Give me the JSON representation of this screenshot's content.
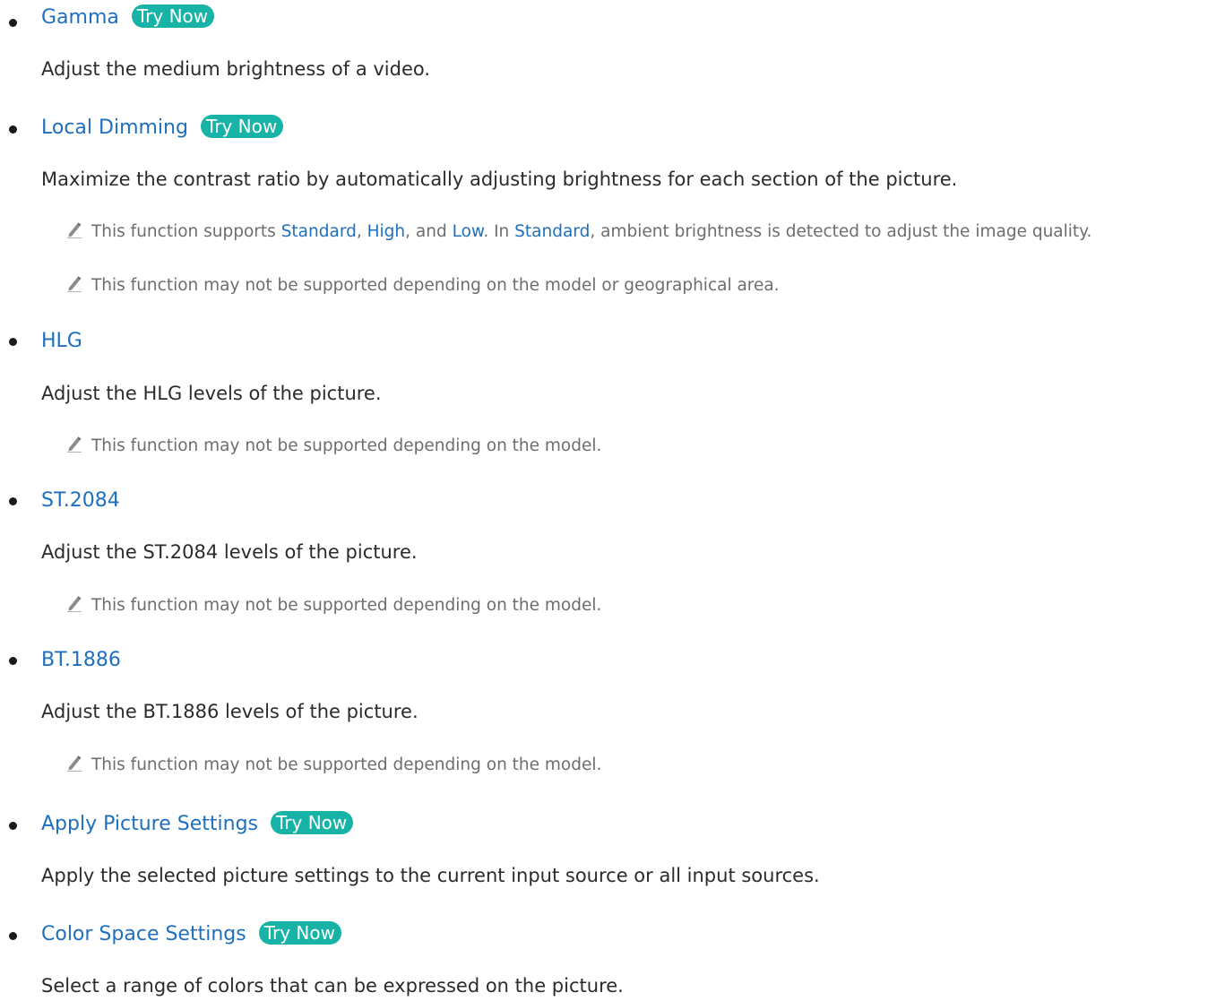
{
  "sections": [
    {
      "title": "Gamma",
      "try_now": "Try Now",
      "description": "Adjust the medium brightness of a video."
    },
    {
      "title": "Local Dimming",
      "try_now": "Try Now",
      "description": "Maximize the contrast ratio by automatically adjusting brightness for each section of the picture.",
      "note1": {
        "t1": "This function supports ",
        "k1": "Standard",
        "t2": ", ",
        "k2": "High",
        "t3": ", and ",
        "k3": "Low",
        "t4": ". In ",
        "k4": "Standard",
        "t5": ", ambient brightness is detected to adjust the image quality."
      },
      "note2": "This function may not be supported depending on the model or geographical area."
    },
    {
      "title": "HLG",
      "description": "Adjust the HLG levels of the picture.",
      "note": "This function may not be supported depending on the model."
    },
    {
      "title": "ST.2084",
      "description": "Adjust the ST.2084 levels of the picture.",
      "note": "This function may not be supported depending on the model."
    },
    {
      "title": "BT.1886",
      "description": "Adjust the BT.1886 levels of the picture.",
      "note": "This function may not be supported depending on the model."
    },
    {
      "title": "Apply Picture Settings",
      "try_now": "Try Now",
      "description": "Apply the selected picture settings to the current input source or all input sources."
    },
    {
      "title": "Color Space Settings",
      "try_now": "Try Now",
      "description": "Select a range of colors that can be expressed on the picture."
    }
  ],
  "colors": {
    "heading": "#1f6fbf",
    "try_now_bg": "#17b3a6",
    "body_text": "#2b2b2b",
    "note_text": "#6d6d6d"
  },
  "icons": {
    "note": "pencil-icon",
    "bullet": "bullet-dot"
  }
}
